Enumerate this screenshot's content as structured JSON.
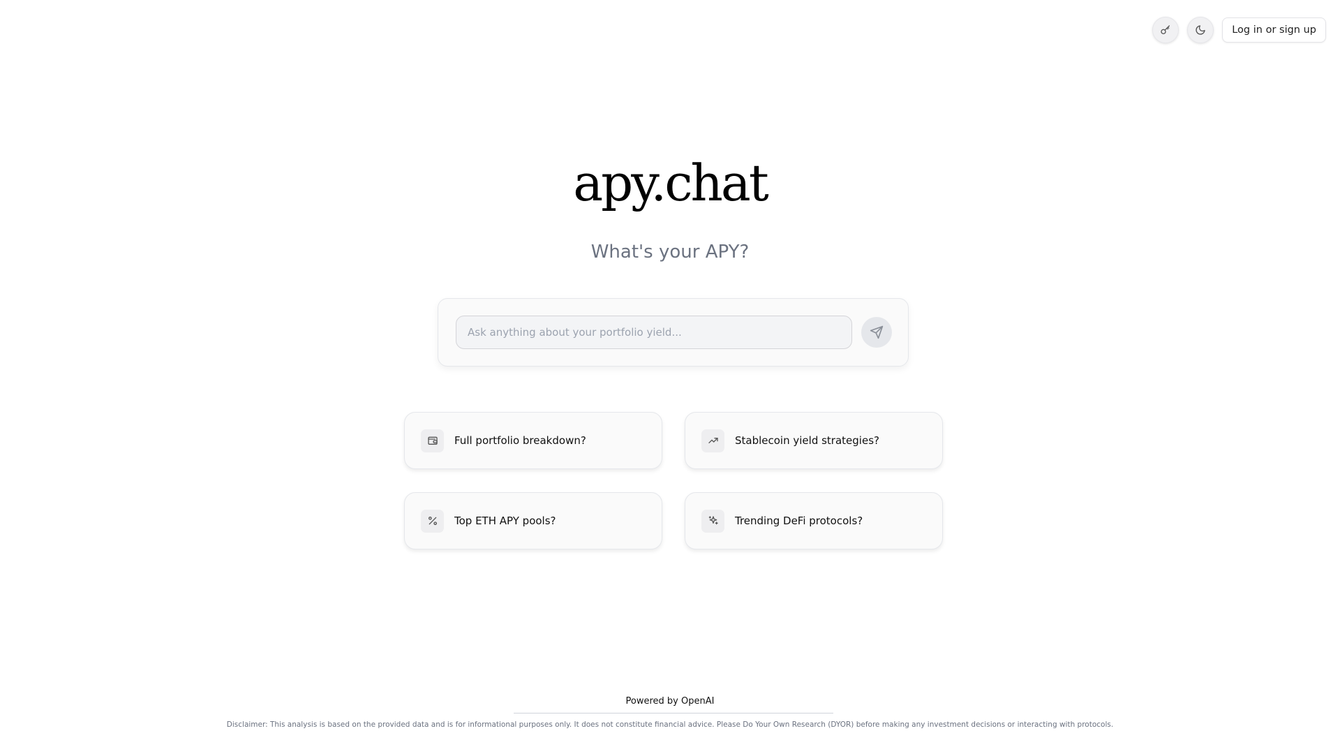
{
  "header": {
    "key_button_icon": "key-icon",
    "theme_button_icon": "moon-icon",
    "login_label": "Log in or sign up"
  },
  "hero": {
    "logo": "apy.chat",
    "tagline": "What's your APY?"
  },
  "search": {
    "placeholder": "Ask anything about your portfolio yield...",
    "value": "",
    "send_icon": "send-icon"
  },
  "suggestions": [
    {
      "label": "Full portfolio breakdown?",
      "icon": "wallet-icon"
    },
    {
      "label": "Stablecoin yield strategies?",
      "icon": "trending-up-icon"
    },
    {
      "label": "Top ETH APY pools?",
      "icon": "percent-icon"
    },
    {
      "label": "Trending DeFi protocols?",
      "icon": "sparkles-icon"
    }
  ],
  "footer": {
    "powered_by": "Powered by OpenAI",
    "disclaimer": "Disclaimer: This analysis is based on the provided data and is for informational purposes only. It does not constitute financial advice. Please Do Your Own Research (DYOR) before making any investment decisions or interacting with protocols."
  },
  "colors": {
    "background": "#ffffff",
    "muted_text": "#6b7280",
    "card_background": "#fafafa",
    "border": "#e5e7eb"
  }
}
